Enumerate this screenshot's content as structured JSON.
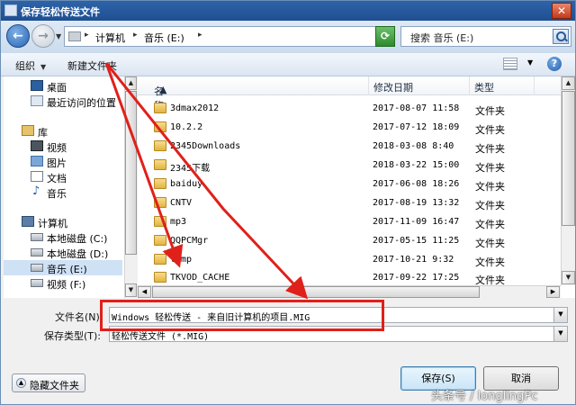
{
  "window": {
    "title": "保存轻松传送文件",
    "close_label": "✕"
  },
  "nav": {
    "back_glyph": "←",
    "forward_glyph": "→",
    "breadcrumbs": [
      "计算机",
      "音乐 (E:)"
    ],
    "search_placeholder": "搜索 音乐 (E:)"
  },
  "commands": {
    "organize": "组织",
    "new_folder": "新建文件夹",
    "help": "?"
  },
  "sidebar": {
    "items": [
      {
        "label": "桌面",
        "icon": "desktop-icon"
      },
      {
        "label": "最近访问的位置",
        "icon": "recent-places-icon"
      },
      {
        "label": "库",
        "icon": "library-icon"
      },
      {
        "label": "视频",
        "icon": "video-icon"
      },
      {
        "label": "图片",
        "icon": "pictures-icon"
      },
      {
        "label": "文档",
        "icon": "documents-icon"
      },
      {
        "label": "音乐",
        "icon": "music-icon"
      },
      {
        "label": "计算机",
        "icon": "computer-icon"
      },
      {
        "label": "本地磁盘 (C:)",
        "icon": "drive-icon"
      },
      {
        "label": "本地磁盘 (D:)",
        "icon": "drive-icon"
      },
      {
        "label": "音乐 (E:)",
        "icon": "drive-icon",
        "selected": true
      },
      {
        "label": "视频 (F:)",
        "icon": "drive-icon"
      }
    ]
  },
  "columns": {
    "name": "名称",
    "modified": "修改日期",
    "type": "类型"
  },
  "files": [
    {
      "name": "3dmax2012",
      "date": "2017-08-07 11:58",
      "type": "文件夹"
    },
    {
      "name": "10.2.2",
      "date": "2017-07-12 18:09",
      "type": "文件夹"
    },
    {
      "name": "2345Downloads",
      "date": "2018-03-08 8:40",
      "type": "文件夹"
    },
    {
      "name": "2345下载",
      "date": "2018-03-22 15:00",
      "type": "文件夹"
    },
    {
      "name": "baiduy",
      "date": "2017-06-08 18:26",
      "type": "文件夹"
    },
    {
      "name": "CNTV",
      "date": "2017-08-19 13:32",
      "type": "文件夹"
    },
    {
      "name": "mp3",
      "date": "2017-11-09 16:47",
      "type": "文件夹"
    },
    {
      "name": "QQPCMgr",
      "date": "2017-05-15 11:25",
      "type": "文件夹"
    },
    {
      "name": "temp",
      "date": "2017-10-21 9:32",
      "type": "文件夹"
    },
    {
      "name": "TKVOD_CACHE",
      "date": "2017-09-22 17:25",
      "type": "文件夹"
    }
  ],
  "form": {
    "filename_label": "文件名(N):",
    "filename_value": "Windows 轻松传送 - 来自旧计算机的项目.MIG",
    "filetype_label": "保存类型(T):",
    "filetype_value": "轻松传送文件 (*.MIG)"
  },
  "buttons": {
    "hide_folders": "隐藏文件夹",
    "save": "保存(S)",
    "cancel": "取消"
  },
  "watermark": "头条号 / longlingPc",
  "colors": {
    "titlebar": "#1f4f91",
    "annotation": "#e0201a",
    "folder": "#e3b43f"
  }
}
